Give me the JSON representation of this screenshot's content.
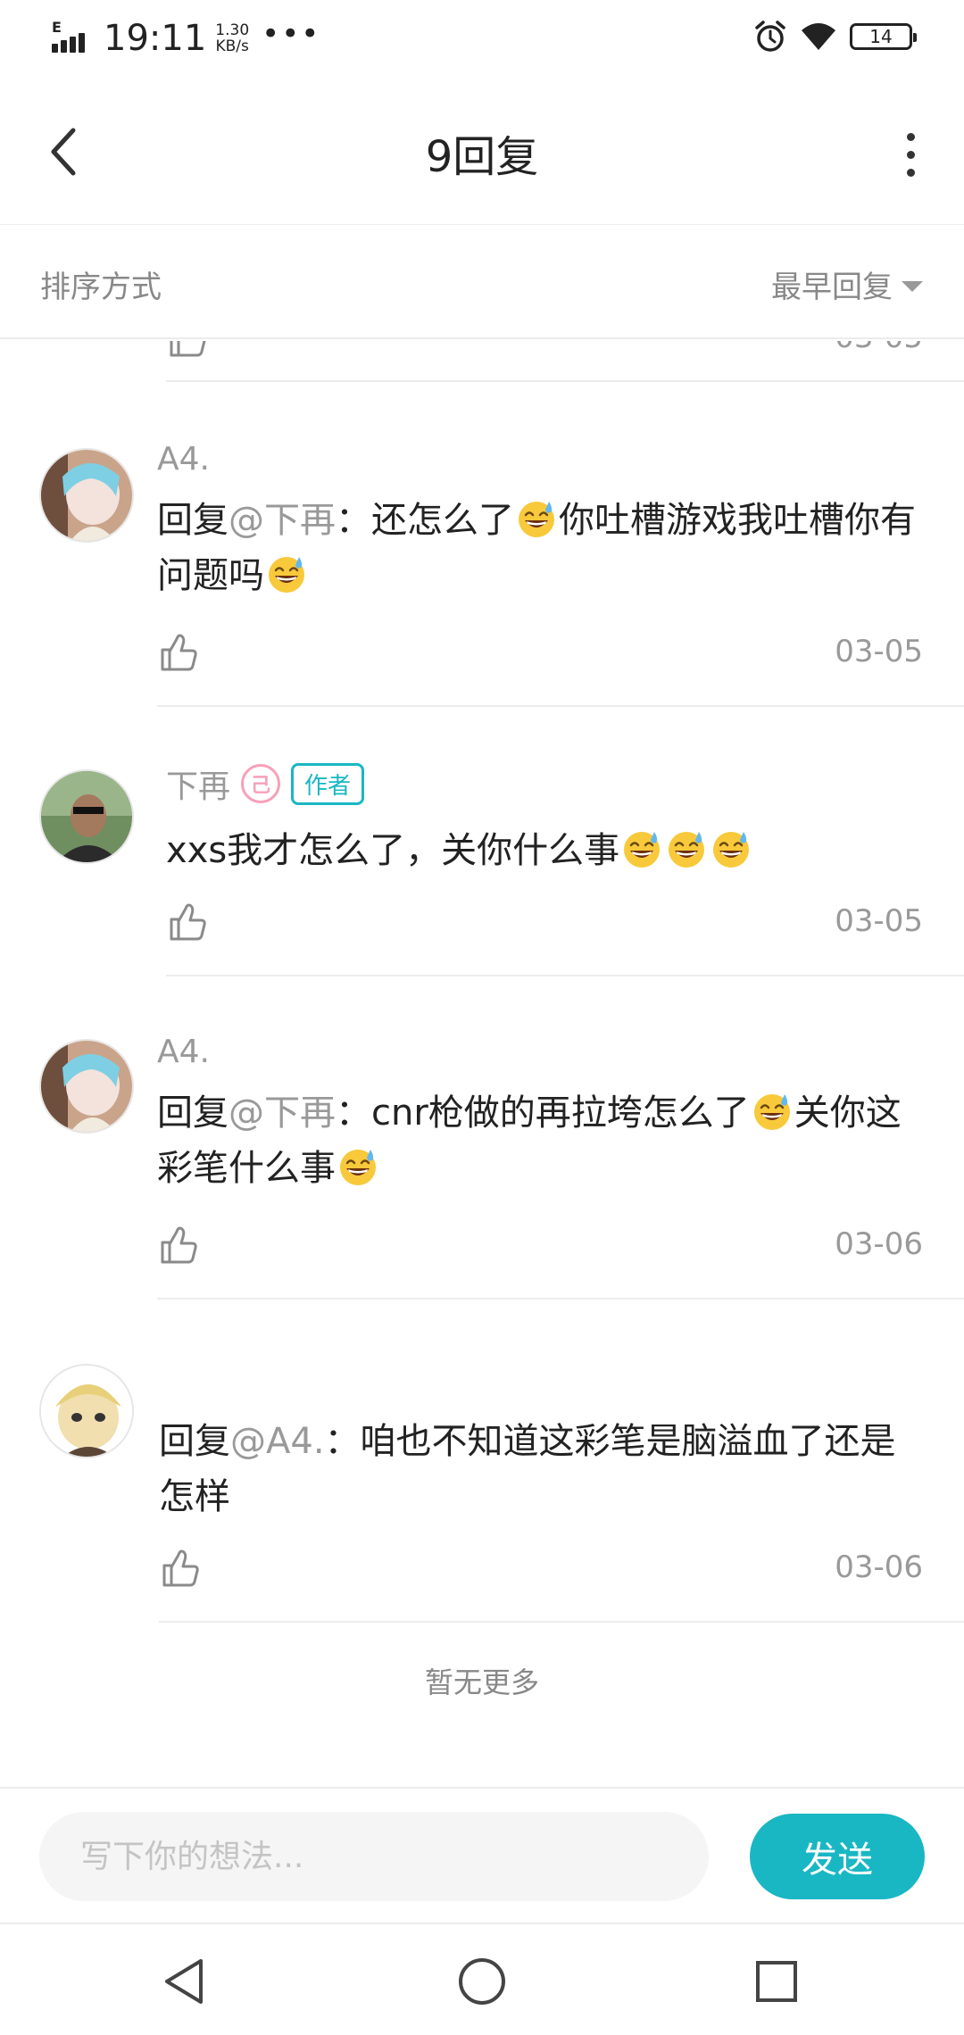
{
  "status_bar": {
    "network": "E",
    "time": "19:11",
    "speed_value": "1.30",
    "speed_unit": "KB/s",
    "more": "•••",
    "battery": "14"
  },
  "header": {
    "title": "9回复"
  },
  "sort": {
    "label": "排序方式",
    "selected": "最早回复"
  },
  "partial_item": {
    "date": "03-05"
  },
  "comments": [
    {
      "name": "A4.",
      "prefix": "回复",
      "mention": "@下再",
      "colon": "：",
      "text1": "还怎么了",
      "text2": "你吐槽游戏我吐槽你有问题吗",
      "date": "03-05"
    },
    {
      "name": "下再",
      "level": "己",
      "badge": "作者",
      "text1": "xxs我才怎么了，关你什么事",
      "date": "03-05"
    },
    {
      "name": "A4.",
      "prefix": "回复",
      "mention": "@下再",
      "colon": "：",
      "text1": "cnr枪做的再拉垮怎么了",
      "text2": "关你这彩笔什么事",
      "date": "03-06"
    },
    {
      "name": "",
      "prefix": "回复",
      "mention": "@A4.",
      "colon": "：",
      "text1": "咱也不知道这彩笔是脑溢血了还是怎样",
      "date": "03-06"
    }
  ],
  "footer": {
    "no_more": "暂无更多"
  },
  "input": {
    "placeholder": "写下你的想法...",
    "send_label": "发送"
  },
  "colors": {
    "accent": "#19b7c4",
    "muted_text": "#999999",
    "divider": "#ececec"
  },
  "icons": [
    "back-arrow-icon",
    "more-vertical-icon",
    "caret-down-icon",
    "thumbs-up-icon",
    "grin-sweat-emoji",
    "nav-back-icon",
    "nav-home-icon",
    "nav-recent-icon",
    "alarm-icon",
    "wifi-icon",
    "battery-icon",
    "signal-icon"
  ]
}
